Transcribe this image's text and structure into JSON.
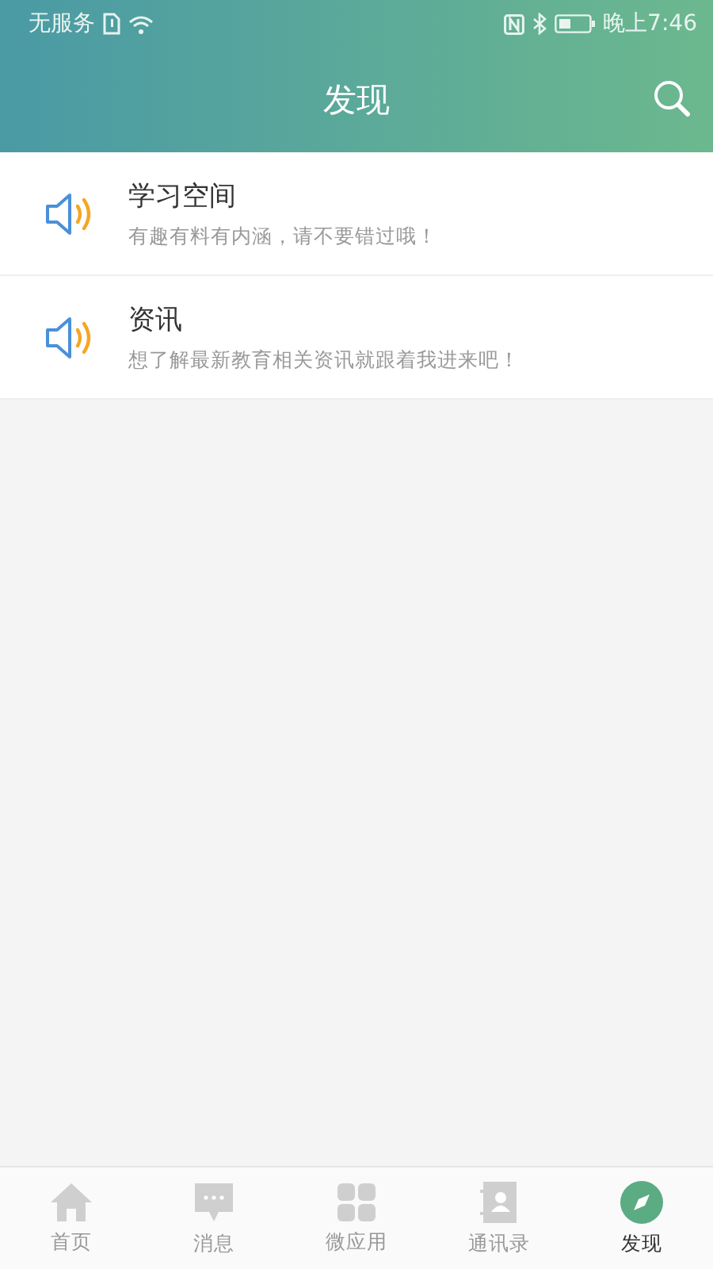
{
  "status_bar": {
    "carrier": "无服务",
    "time": "晚上7:46"
  },
  "header": {
    "title": "发现"
  },
  "items": [
    {
      "title": "学习空间",
      "subtitle": "有趣有料有内涵，请不要错过哦！"
    },
    {
      "title": "资讯",
      "subtitle": "想了解最新教育相关资讯就跟着我进来吧！"
    }
  ],
  "tab_bar": [
    {
      "label": "首页",
      "kind": "home",
      "selected": false
    },
    {
      "label": "消息",
      "kind": "message",
      "selected": false
    },
    {
      "label": "微应用",
      "kind": "apps",
      "selected": false
    },
    {
      "label": "通讯录",
      "kind": "contacts",
      "selected": false
    },
    {
      "label": "发现",
      "kind": "discover",
      "selected": true
    }
  ]
}
